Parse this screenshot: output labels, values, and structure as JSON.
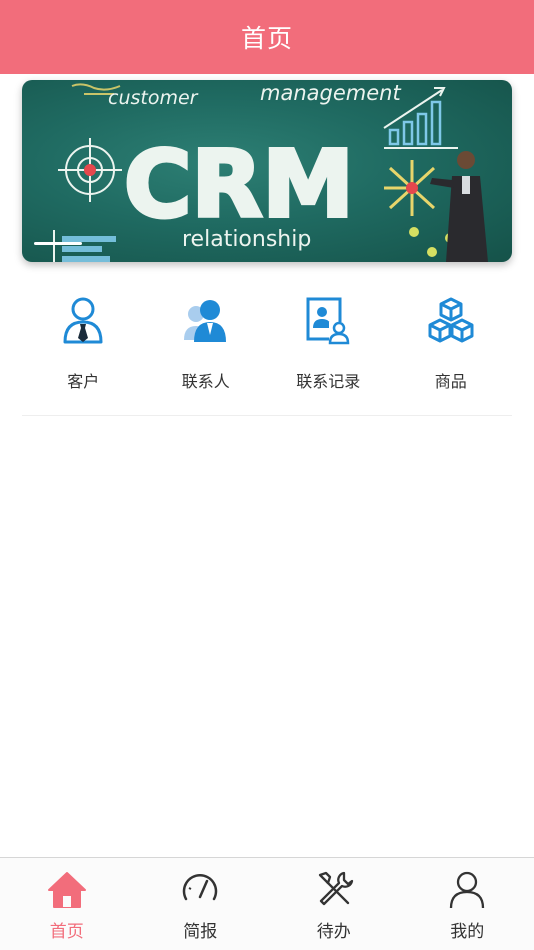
{
  "header": {
    "title": "首页"
  },
  "banner": {
    "lines": [
      "customer",
      "management",
      "CRM",
      "relationship"
    ]
  },
  "quick_menu": [
    {
      "label": "客户",
      "icon": "customer-icon"
    },
    {
      "label": "联系人",
      "icon": "contacts-icon"
    },
    {
      "label": "联系记录",
      "icon": "contact-record-icon"
    },
    {
      "label": "商品",
      "icon": "products-icon"
    }
  ],
  "tabbar": [
    {
      "label": "首页",
      "icon": "home-icon",
      "active": true
    },
    {
      "label": "简报",
      "icon": "gauge-icon",
      "active": false
    },
    {
      "label": "待办",
      "icon": "tools-icon",
      "active": false
    },
    {
      "label": "我的",
      "icon": "user-icon",
      "active": false
    }
  ],
  "colors": {
    "accent": "#f26d7b",
    "icon_blue": "#1f8ad6",
    "text": "#333333"
  }
}
